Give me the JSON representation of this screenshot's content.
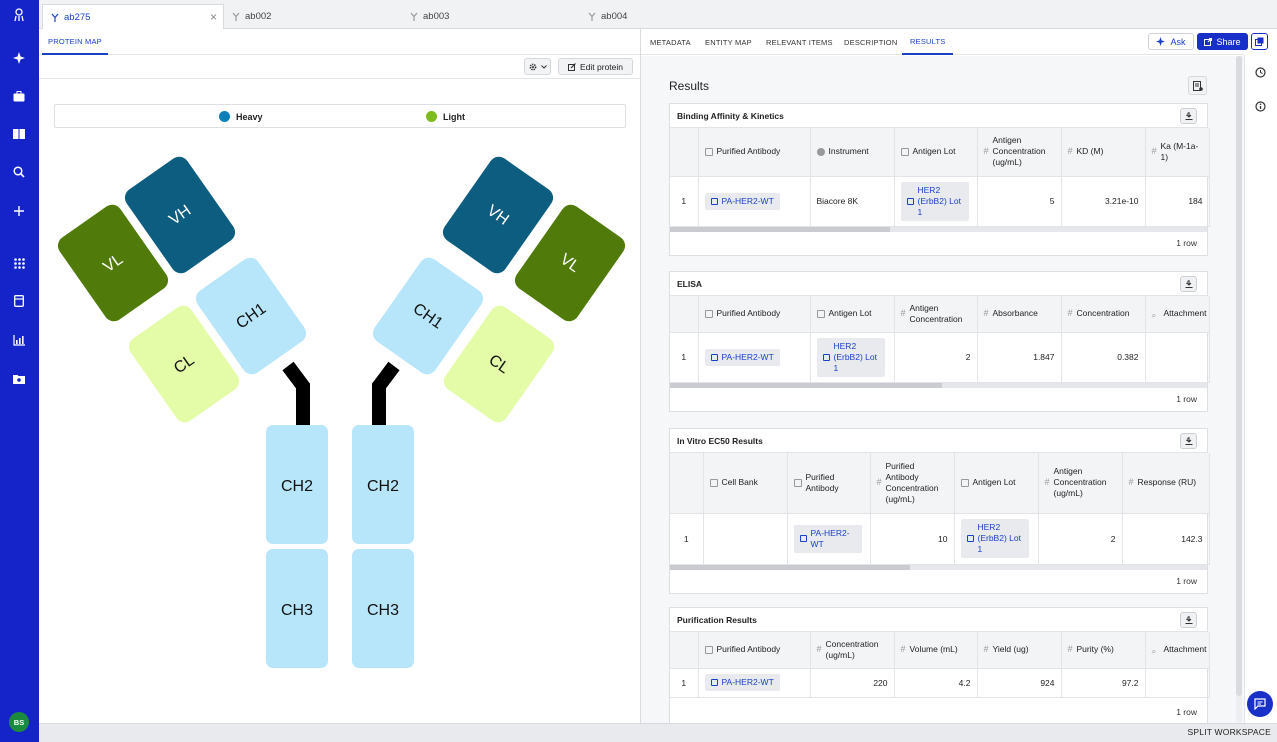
{
  "user": {
    "initials": "BS"
  },
  "tabs": [
    {
      "label": "ab275",
      "active": true
    },
    {
      "label": "ab002"
    },
    {
      "label": "ab003"
    },
    {
      "label": "ab004"
    }
  ],
  "left": {
    "subtab": "PROTEIN MAP",
    "edit_label": "Edit protein",
    "legend": {
      "heavy": "Heavy",
      "light": "Light",
      "heavy_color": "#0a7fb8",
      "light_color": "#7dbb1e"
    },
    "domains": {
      "vh": "VH",
      "vl": "VL",
      "ch1": "CH1",
      "cl": "CL",
      "ch2": "CH2",
      "ch3": "CH3"
    },
    "colors": {
      "vh": "#0d5d80",
      "vl": "#507a0a",
      "ch": "#b7e6fb",
      "cl": "#e4fca7"
    }
  },
  "right": {
    "subtabs": [
      "METADATA",
      "ENTITY MAP",
      "RELEVANT ITEMS",
      "DESCRIPTION",
      "RESULTS"
    ],
    "ask_label": "Ask",
    "share_label": "Share",
    "results_title": "Results",
    "sections": {
      "binding": {
        "title": "Binding Affinity & Kinetics",
        "headers": [
          "Purified Antibody",
          "Instrument",
          "Antigen Lot",
          "Antigen Concentration (ug/mL)",
          "KD (M)",
          "Ka (M-1a-1)"
        ],
        "row": {
          "index": "1",
          "antibody": "PA-HER2-WT",
          "instrument": "Biacore 8K",
          "lot": "HER2 (ErbB2) Lot 1",
          "conc": "5",
          "kd": "3.21e-10",
          "ka": "184"
        },
        "footer": "1 row"
      },
      "elisa": {
        "title": "ELISA",
        "headers": [
          "Purified Antibody",
          "Antigen Lot",
          "Antigen Concentration",
          "Absorbance",
          "Concentration",
          "Attachment"
        ],
        "row": {
          "index": "1",
          "antibody": "PA-HER2-WT",
          "lot": "HER2 (ErbB2) Lot 1",
          "conc": "2",
          "absorbance": "1.847",
          "concentration": "0.382"
        },
        "footer": "1 row"
      },
      "ec50": {
        "title": "In Vitro EC50 Results",
        "headers": [
          "Cell Bank",
          "Purified Antibody",
          "Purified Antibody Concentration (ug/mL)",
          "Antigen Lot",
          "Antigen Concentration (ug/mL)",
          "Response (RU)"
        ],
        "row": {
          "index": "1",
          "antibody": "PA-HER2-WT",
          "pac": "10",
          "lot": "HER2 (ErbB2) Lot 1",
          "conc": "2",
          "response": "142.3"
        },
        "footer": "1 row"
      },
      "purification": {
        "title": "Purification Results",
        "headers": [
          "Purified Antibody",
          "Concentration (ug/mL)",
          "Volume (mL)",
          "Yield (ug)",
          "Purity (%)",
          "Attachment"
        ],
        "row": {
          "index": "1",
          "antibody": "PA-HER2-WT",
          "conc": "220",
          "volume": "4.2",
          "yield": "924",
          "purity": "97.2"
        },
        "footer": "1 row"
      }
    }
  },
  "bottom": {
    "split_label": "SPLIT WORKSPACE"
  }
}
